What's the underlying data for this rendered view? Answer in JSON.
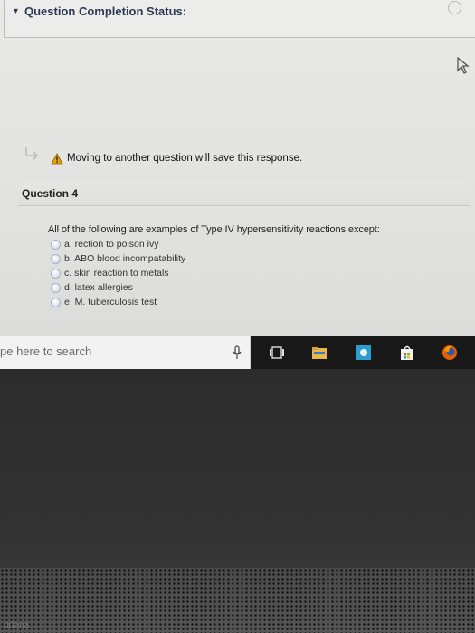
{
  "status": {
    "title": "Question Completion Status:"
  },
  "notice": {
    "text": "Moving to another question will save this response."
  },
  "question": {
    "title": "Question 4",
    "prompt": "All of the following are examples of Type IV hypersensitivity reactions except:",
    "options": [
      {
        "label": "a. rection to poison ivy"
      },
      {
        "label": "b. ABO blood incompatability"
      },
      {
        "label": "c. skin reaction to metals"
      },
      {
        "label": "d. latex allergies"
      },
      {
        "label": "e. M. tuberculosis test"
      }
    ]
  },
  "taskbar": {
    "search_text": "pe here to search",
    "bottom_label": "ortana"
  },
  "icons": {
    "arrow": "return-arrow-icon",
    "warning": "warning-icon",
    "mic": "microphone-icon",
    "task_view": "task-view-icon",
    "file_explorer": "file-explorer-icon",
    "store": "store-icon",
    "shop": "shopping-bag-icon",
    "firefox": "firefox-icon"
  },
  "colors": {
    "warning": "#e8a20c",
    "heading": "#2c3a54",
    "radio": "#c9d6e2",
    "firefox": "#e66000"
  }
}
